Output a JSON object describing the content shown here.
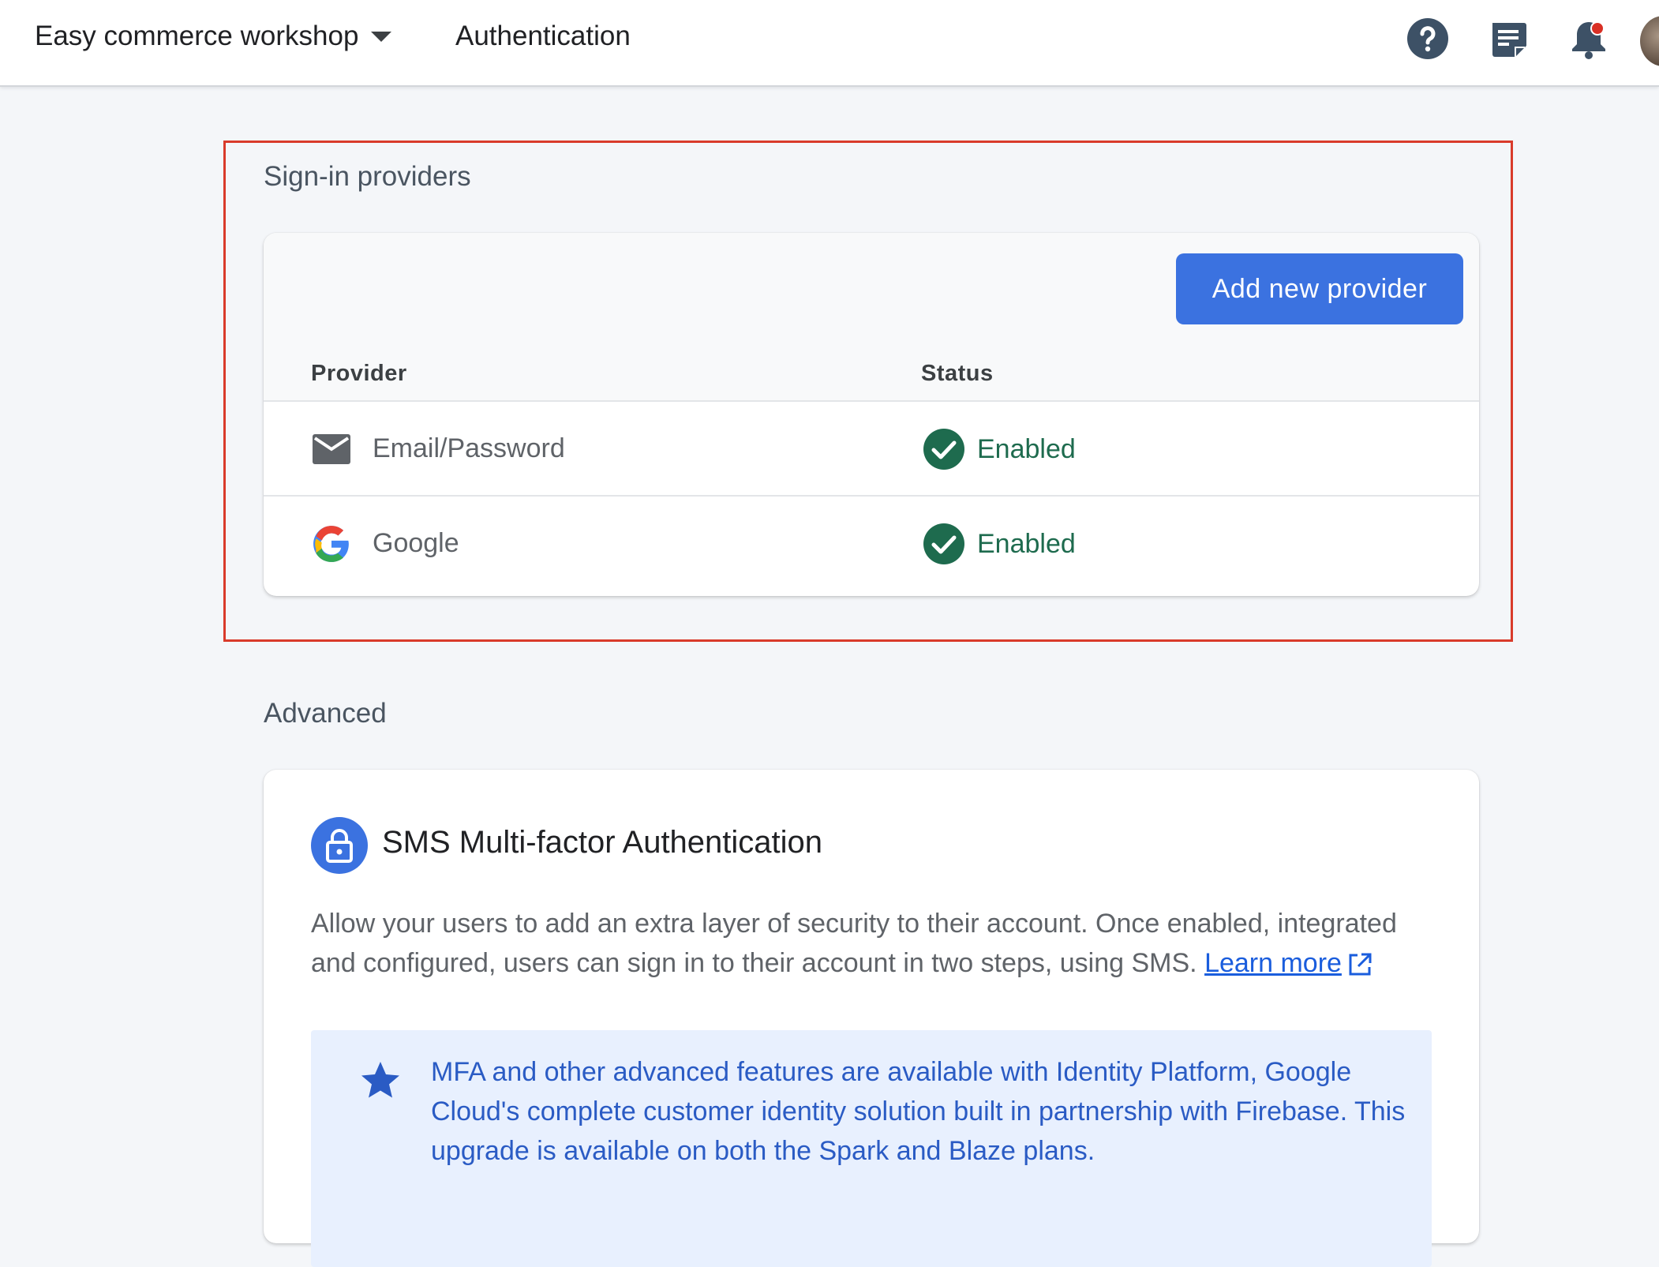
{
  "header": {
    "project_name": "Easy commerce workshop",
    "page_name": "Authentication",
    "icons": [
      "help-icon",
      "feedback-icon",
      "notifications-icon",
      "account-avatar"
    ]
  },
  "signin": {
    "section_title": "Sign-in providers",
    "add_button_label": "Add new provider",
    "columns": {
      "provider": "Provider",
      "status": "Status"
    },
    "providers": [
      {
        "name": "Email/Password",
        "icon": "email-icon",
        "status": "Enabled"
      },
      {
        "name": "Google",
        "icon": "google-icon",
        "status": "Enabled"
      }
    ]
  },
  "advanced": {
    "section_title": "Advanced",
    "mfa_title": "SMS Multi-factor Authentication",
    "mfa_description": "Allow your users to add an extra layer of security to their account. Once enabled, integrated and configured, users can sign in to their account in two steps, using SMS.",
    "learn_more_label": "Learn more",
    "promo_text": "MFA and other advanced features are available with Identity Platform, Google Cloud's complete customer identity solution built in partnership with Firebase. This upgrade is available on both the Spark and Blaze plans."
  },
  "colors": {
    "accent": "#3b72e0",
    "status_green": "#1e6b4e",
    "highlight_border": "#d93b2b",
    "promo_bg": "#e8f0fe"
  }
}
